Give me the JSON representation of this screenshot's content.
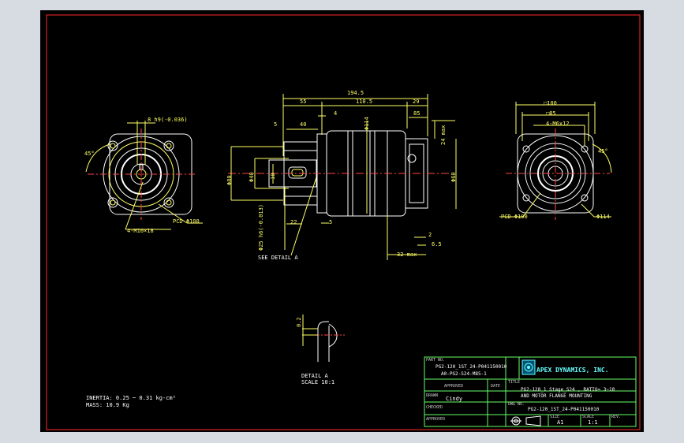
{
  "top_dims": {
    "overall": "194.5",
    "d55": "55",
    "d110": "110.5",
    "d29": "29",
    "d5": "5",
    "d40": "40",
    "d4": "4",
    "d114v": "Φ114",
    "d85": "85",
    "d24max": "24 max",
    "d80": "Φ80",
    "d40v": "Φ40",
    "d10": "10",
    "d60": "Φ60",
    "d22": "22",
    "d5b": "5",
    "d25": "Φ25 h6(-0.013)",
    "d2": "2",
    "d65": "6.5",
    "d32max": "32 max"
  },
  "left_view": {
    "keyway": "8 h9(-0.036)",
    "angle": "45°",
    "holes": "4-M10×18",
    "pcd": "PCD Φ100"
  },
  "right_view": {
    "sq100": "□100",
    "sq85": "□85",
    "holes": "4-M6x12",
    "angle": "45°",
    "pcd": "PCD Φ100",
    "dia": "Φ114"
  },
  "labels": {
    "see_detail": "SEE DETAIL A",
    "detail_title": "DETAIL A",
    "detail_scale": "SCALE 10:1",
    "detail_dim": "0.2",
    "inertia": "INERTIA: 0.25 ~ 0.31 kg-cm²",
    "mass": "MASS: 10.9  Kg"
  },
  "title_block": {
    "part_no_label": "PART NO.",
    "part_no_1": "PG2-120_1ST_24-P041150010",
    "part_no_2": "A0-PG2-S24-M85-1",
    "company": "APEX DYNAMICS, INC.",
    "approved_label": "APPROVED",
    "date_label": "DATE",
    "title_label": "TITLE",
    "title_1": "PG2-120_1 Stage_S24 , RATIO= 3~10",
    "title_2": "AND MOTOR FLANGE MOUNTING",
    "drawn_label": "DRAWN",
    "drawn_by": "Cindy",
    "checked_label": "CHECKED",
    "dwg_no_label": "DWG NO.",
    "dwg_no": "PG2-120_1ST_24-P041150010",
    "approved2_label": "APPROVED",
    "size_label": "SIZE",
    "size": "A1",
    "scale_label": "SCALE",
    "scale": "1:1",
    "rev_label": "REV."
  }
}
